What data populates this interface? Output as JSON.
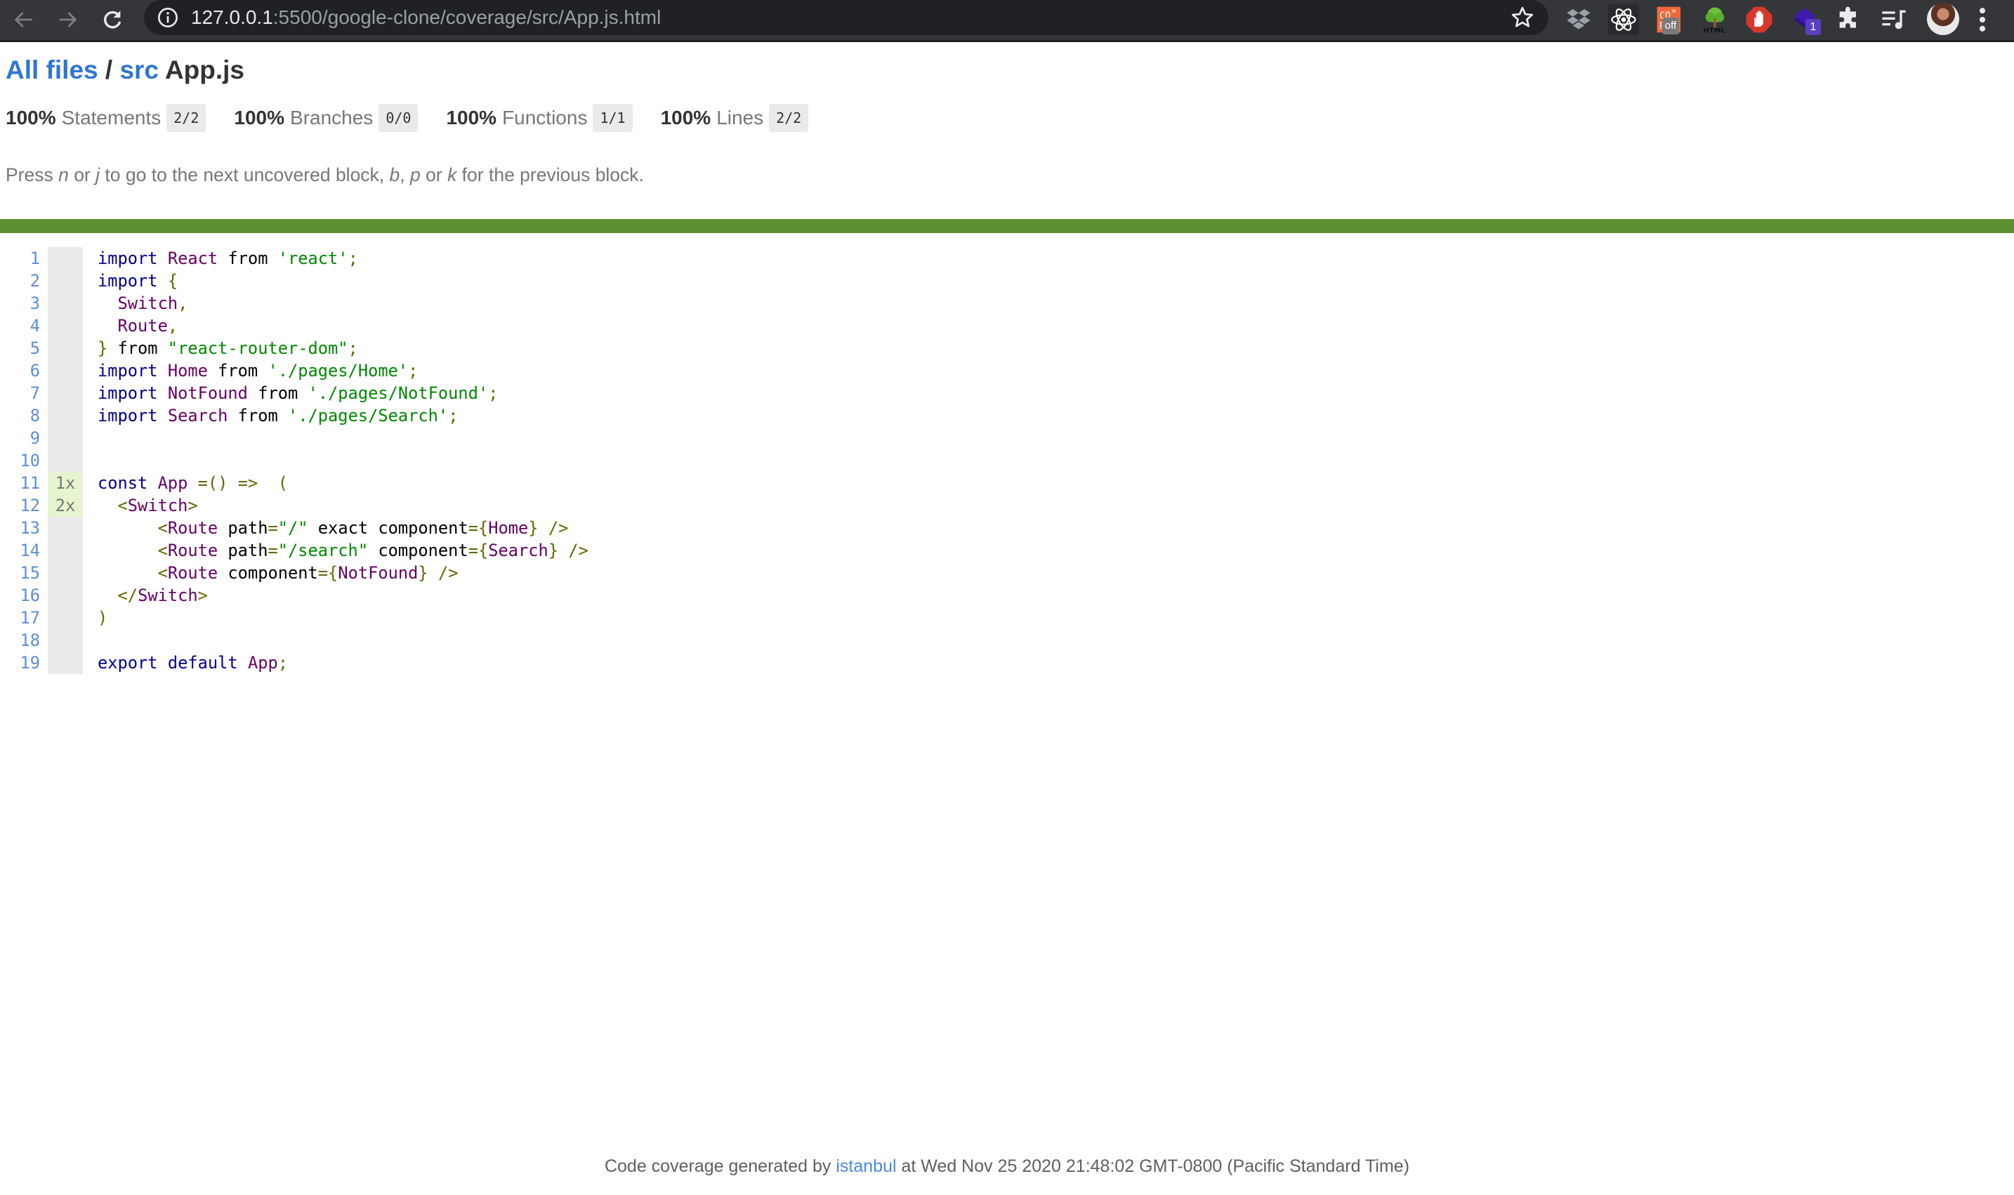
{
  "browser": {
    "url_host": "127.0.0.1",
    "url_rest": ":5500/google-clone/coverage/src/App.js.html",
    "toolbar_icons": [
      "back-arrow-icon",
      "forward-arrow-icon",
      "reload-icon",
      "site-info-icon",
      "bookmark-star-icon"
    ],
    "extensions": [
      {
        "name": "dropbox-icon"
      },
      {
        "name": "react-devtools-icon"
      },
      {
        "name": "cors-extension-icon",
        "badge": "off"
      },
      {
        "name": "html-tree-icon",
        "label": "HTML"
      },
      {
        "name": "adblock-stop-hand-icon"
      },
      {
        "name": "purple-diamond-extension-icon",
        "badge": "1"
      },
      {
        "name": "extensions-puzzle-icon"
      },
      {
        "name": "media-control-icon"
      },
      {
        "name": "profile-avatar"
      },
      {
        "name": "menu-kebab-icon"
      }
    ]
  },
  "header": {
    "breadcrumb_all_files": "All files",
    "breadcrumb_sep": " / ",
    "breadcrumb_src": "src",
    "file_name": "App.js"
  },
  "stats": [
    {
      "pct": "100%",
      "label": "Statements",
      "fraction": "2/2"
    },
    {
      "pct": "100%",
      "label": "Branches",
      "fraction": "0/0"
    },
    {
      "pct": "100%",
      "label": "Functions",
      "fraction": "1/1"
    },
    {
      "pct": "100%",
      "label": "Lines",
      "fraction": "2/2"
    }
  ],
  "help": {
    "t1": "Press ",
    "k1": "n",
    "t2": " or ",
    "k2": "j",
    "t3": " to go to the next uncovered block, ",
    "k3": "b",
    "t4": ", ",
    "k4": "p",
    "t5": " or ",
    "k5": "k",
    "t6": " for the previous block."
  },
  "coverage_status_color": "#5d8f33",
  "code": {
    "lines": [
      {
        "n": "1",
        "hits": "",
        "tokens": [
          [
            "k",
            "import"
          ],
          [
            "pl",
            " "
          ],
          [
            "t",
            "React"
          ],
          [
            "pl",
            " from "
          ],
          [
            "s",
            "'react'"
          ],
          [
            "p",
            ";"
          ]
        ]
      },
      {
        "n": "2",
        "hits": "",
        "tokens": [
          [
            "k",
            "import"
          ],
          [
            "pl",
            " "
          ],
          [
            "p",
            "{"
          ]
        ]
      },
      {
        "n": "3",
        "hits": "",
        "tokens": [
          [
            "pl",
            "  "
          ],
          [
            "t",
            "Switch"
          ],
          [
            "p",
            ","
          ]
        ]
      },
      {
        "n": "4",
        "hits": "",
        "tokens": [
          [
            "pl",
            "  "
          ],
          [
            "t",
            "Route"
          ],
          [
            "p",
            ","
          ]
        ]
      },
      {
        "n": "5",
        "hits": "",
        "tokens": [
          [
            "p",
            "}"
          ],
          [
            "pl",
            " from "
          ],
          [
            "s",
            "\"react-router-dom\""
          ],
          [
            "p",
            ";"
          ]
        ]
      },
      {
        "n": "6",
        "hits": "",
        "tokens": [
          [
            "k",
            "import"
          ],
          [
            "pl",
            " "
          ],
          [
            "t",
            "Home"
          ],
          [
            "pl",
            " from "
          ],
          [
            "s",
            "'./pages/Home'"
          ],
          [
            "p",
            ";"
          ]
        ]
      },
      {
        "n": "7",
        "hits": "",
        "tokens": [
          [
            "k",
            "import"
          ],
          [
            "pl",
            " "
          ],
          [
            "t",
            "NotFound"
          ],
          [
            "pl",
            " from "
          ],
          [
            "s",
            "'./pages/NotFound'"
          ],
          [
            "p",
            ";"
          ]
        ]
      },
      {
        "n": "8",
        "hits": "",
        "tokens": [
          [
            "k",
            "import"
          ],
          [
            "pl",
            " "
          ],
          [
            "t",
            "Search"
          ],
          [
            "pl",
            " from "
          ],
          [
            "s",
            "'./pages/Search'"
          ],
          [
            "p",
            ";"
          ]
        ]
      },
      {
        "n": "9",
        "hits": "",
        "tokens": []
      },
      {
        "n": "10",
        "hits": "",
        "tokens": []
      },
      {
        "n": "11",
        "hits": "1x",
        "tokens": [
          [
            "k",
            "const"
          ],
          [
            "pl",
            " "
          ],
          [
            "t",
            "App"
          ],
          [
            "pl",
            " "
          ],
          [
            "p",
            "=()"
          ],
          [
            "pl",
            " "
          ],
          [
            "p",
            "=>"
          ],
          [
            "pl",
            "  "
          ],
          [
            "p",
            "("
          ]
        ]
      },
      {
        "n": "12",
        "hits": "2x",
        "tokens": [
          [
            "pl",
            "  "
          ],
          [
            "p",
            "<"
          ],
          [
            "t",
            "Switch"
          ],
          [
            "p",
            ">"
          ]
        ]
      },
      {
        "n": "13",
        "hits": "",
        "tokens": [
          [
            "pl",
            "      "
          ],
          [
            "p",
            "<"
          ],
          [
            "t",
            "Route"
          ],
          [
            "pl",
            " path"
          ],
          [
            "p",
            "="
          ],
          [
            "s",
            "\"/\""
          ],
          [
            "pl",
            " exact component"
          ],
          [
            "p",
            "={"
          ],
          [
            "t",
            "Home"
          ],
          [
            "p",
            "}"
          ],
          [
            "pl",
            " "
          ],
          [
            "p",
            "/>"
          ]
        ]
      },
      {
        "n": "14",
        "hits": "",
        "tokens": [
          [
            "pl",
            "      "
          ],
          [
            "p",
            "<"
          ],
          [
            "t",
            "Route"
          ],
          [
            "pl",
            " path"
          ],
          [
            "p",
            "="
          ],
          [
            "s",
            "\"/search\""
          ],
          [
            "pl",
            " component"
          ],
          [
            "p",
            "={"
          ],
          [
            "t",
            "Search"
          ],
          [
            "p",
            "}"
          ],
          [
            "pl",
            " "
          ],
          [
            "p",
            "/>"
          ]
        ]
      },
      {
        "n": "15",
        "hits": "",
        "tokens": [
          [
            "pl",
            "      "
          ],
          [
            "p",
            "<"
          ],
          [
            "t",
            "Route"
          ],
          [
            "pl",
            " component"
          ],
          [
            "p",
            "={"
          ],
          [
            "t",
            "NotFound"
          ],
          [
            "p",
            "}"
          ],
          [
            "pl",
            " "
          ],
          [
            "p",
            "/>"
          ]
        ]
      },
      {
        "n": "16",
        "hits": "",
        "tokens": [
          [
            "pl",
            "  "
          ],
          [
            "p",
            "</"
          ],
          [
            "t",
            "Switch"
          ],
          [
            "p",
            ">"
          ]
        ]
      },
      {
        "n": "17",
        "hits": "",
        "tokens": [
          [
            "p",
            ")"
          ]
        ]
      },
      {
        "n": "18",
        "hits": "",
        "tokens": []
      },
      {
        "n": "19",
        "hits": "",
        "tokens": [
          [
            "k",
            "export"
          ],
          [
            "pl",
            " "
          ],
          [
            "k",
            "default"
          ],
          [
            "pl",
            " "
          ],
          [
            "t",
            "App"
          ],
          [
            "p",
            ";"
          ]
        ]
      }
    ]
  },
  "footer": {
    "prefix": "Code coverage generated by ",
    "link": "istanbul",
    "suffix": " at Wed Nov 25 2020 21:48:02 GMT-0800 (Pacific Standard Time)"
  }
}
